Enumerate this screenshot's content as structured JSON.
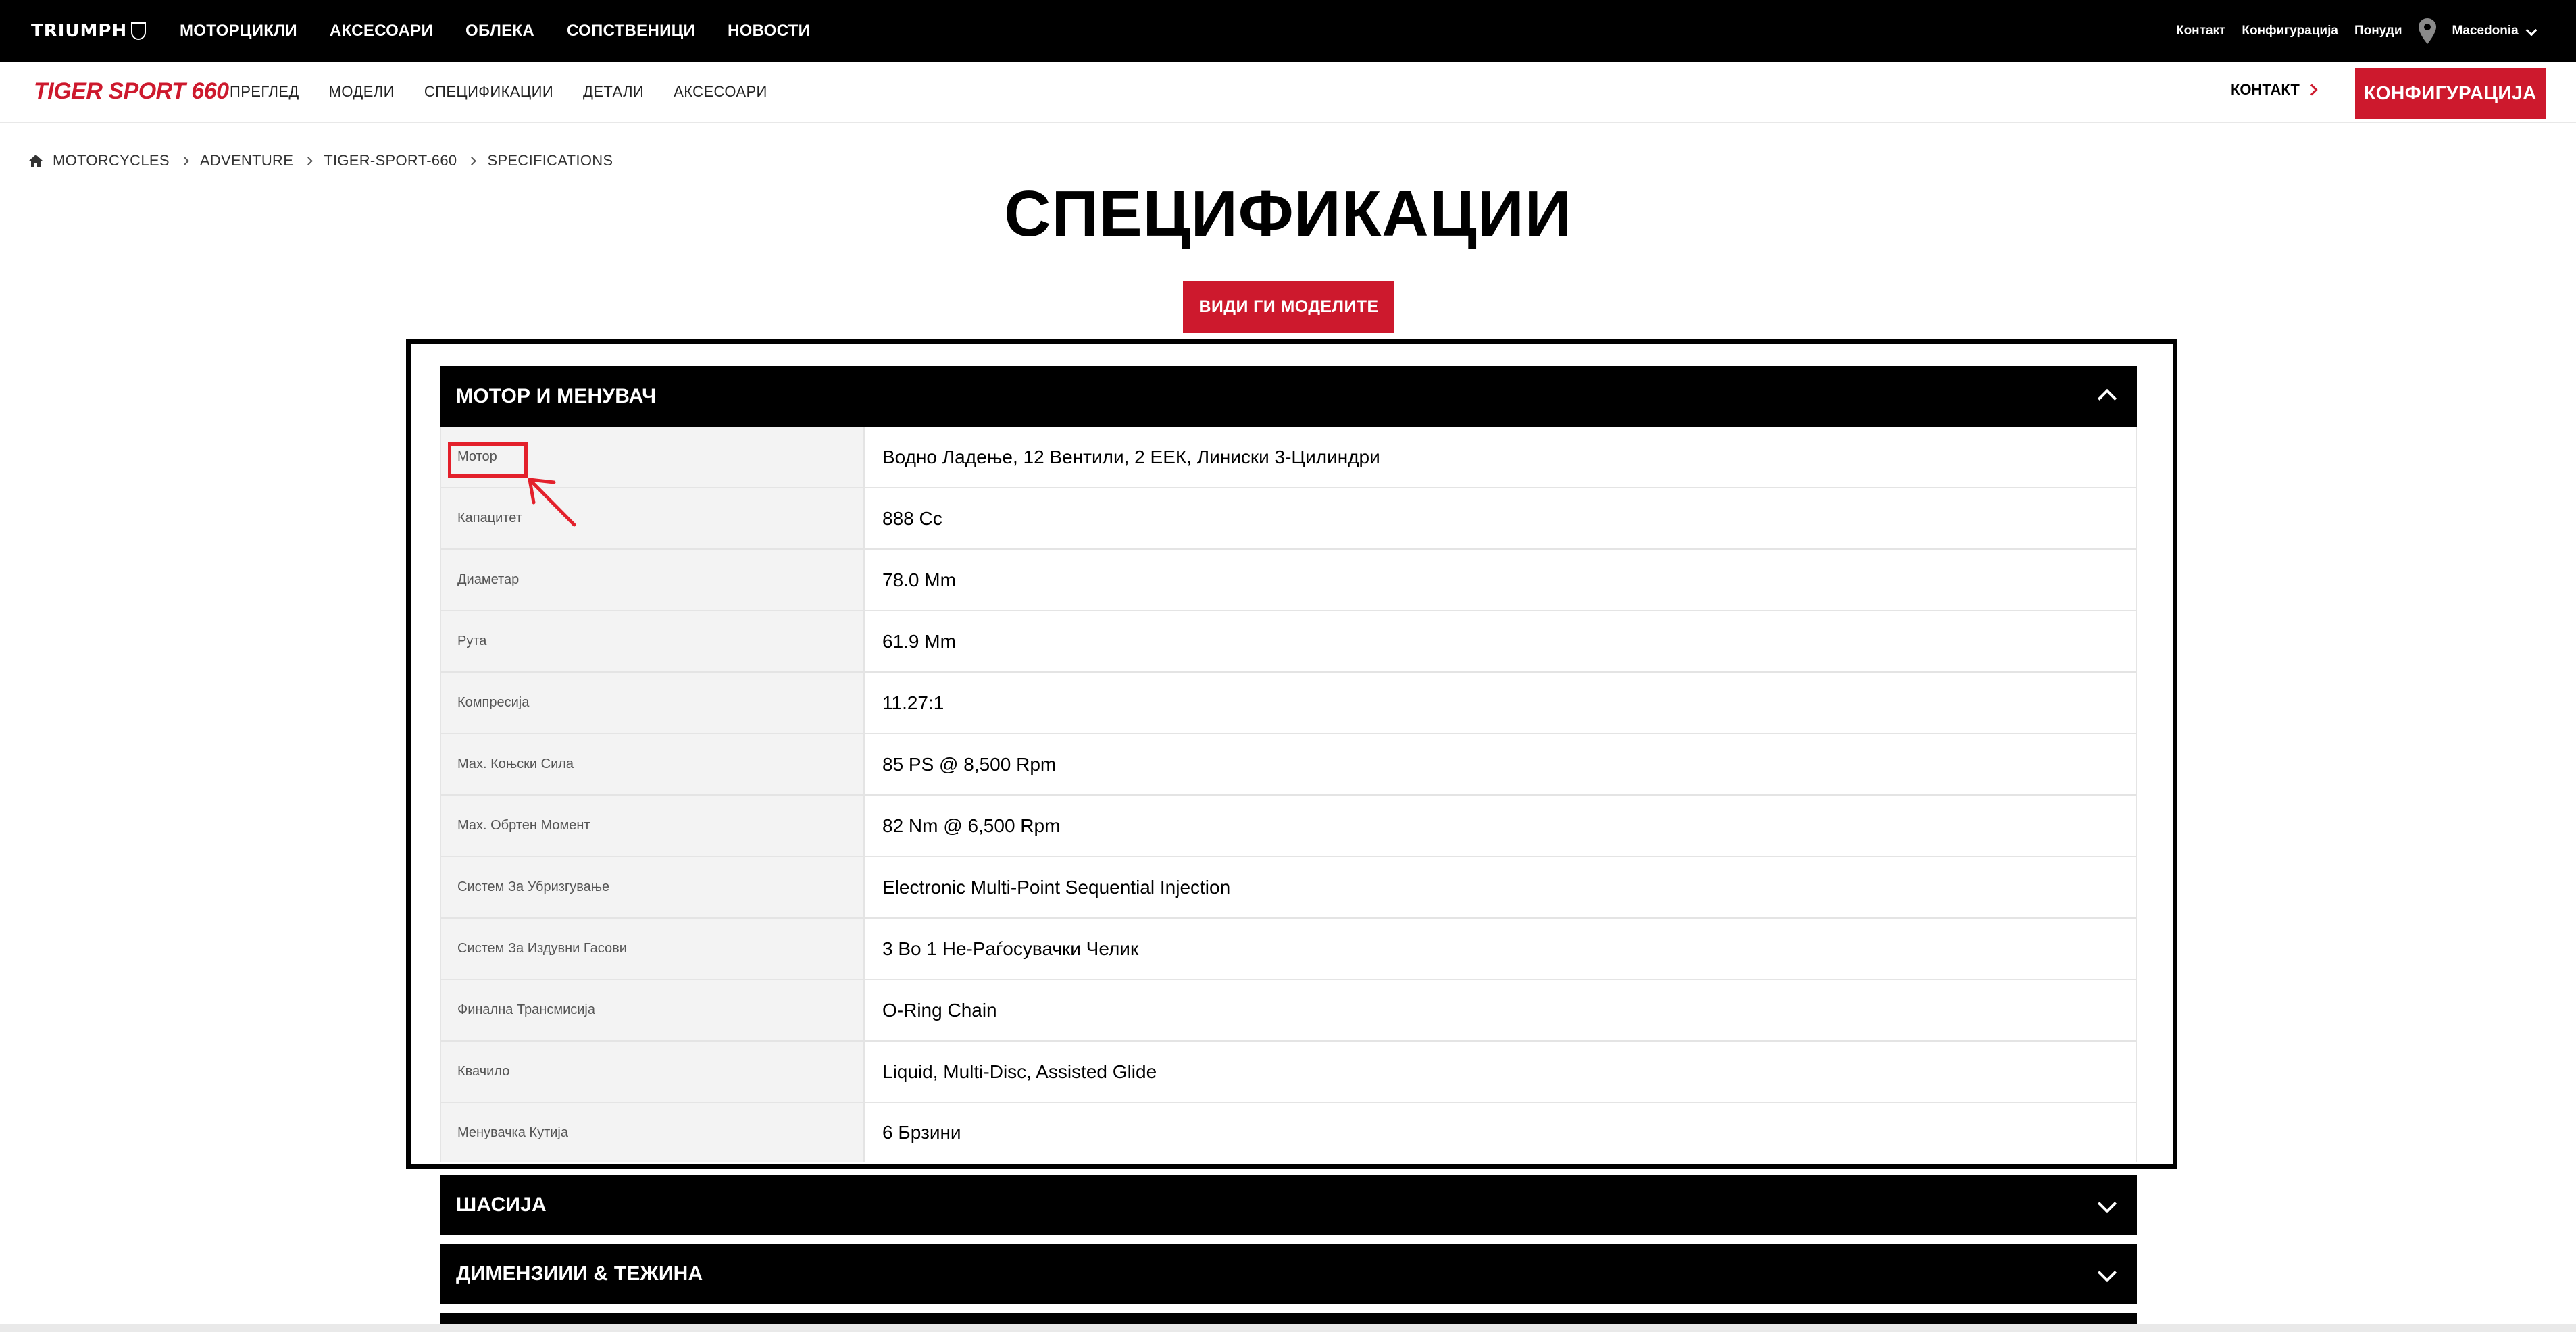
{
  "topbar": {
    "logo_text": "TRIUMPH",
    "nav": [
      "МОТОРЦИКЛИ",
      "АКСЕСОАРИ",
      "ОБЛЕКА",
      "СОПСТВЕНИЦИ",
      "НОВОСТИ"
    ],
    "utility": {
      "contact": "Контакт",
      "config": "Конфигурација",
      "offers": "Понуди",
      "region": "Macedonia",
      "location_icon": "location-pin-icon"
    }
  },
  "subbar": {
    "model_name": "TIGER SPORT 660",
    "nav": [
      "ПРЕГЛЕД",
      "МОДЕЛИ",
      "СПЕЦИФИКАЦИИ",
      "ДЕТАЛИ",
      "АКСЕСОАРИ"
    ],
    "contact_label": "КОНТАКТ",
    "config_button": "КОНФИГУРАЦИЈА"
  },
  "breadcrumb": {
    "home_icon": "home-icon",
    "items": [
      "MOTORCYCLES",
      "ADVENTURE",
      "TIGER-SPORT-660",
      "SPECIFICATIONS"
    ]
  },
  "page": {
    "title": "СПЕЦИФИКАЦИИ",
    "models_button": "ВИДИ ГИ МОДЕЛИТЕ"
  },
  "sections": [
    {
      "title": "МОТОР И МЕНУВАЧ",
      "expanded": true,
      "rows": [
        {
          "label": "Мотор",
          "value": "Водно Ладење, 12 Вентили, 2 ЕЕК, Линиски 3-Цилиндри"
        },
        {
          "label": "Капацитет",
          "value": "888 Cc"
        },
        {
          "label": "Диаметар",
          "value": "78.0 Mm"
        },
        {
          "label": "Рута",
          "value": "61.9 Mm"
        },
        {
          "label": "Компресија",
          "value": "11.27:1"
        },
        {
          "label": "Мах. Коњски Сила",
          "value": "85 PS @ 8,500 Rpm"
        },
        {
          "label": "Мах. Обртен Момент",
          "value": "82 Nm @ 6,500 Rpm"
        },
        {
          "label": "Систем За Убризгување",
          "value": "Electronic Multi-Point Sequential Injection"
        },
        {
          "label": "Систем За Издувни Гасови",
          "value": "3 Во 1 Не-Рaѓосувачки Челик"
        },
        {
          "label": "Финална Трансмисија",
          "value": "O-Ring Chain"
        },
        {
          "label": "Квачило",
          "value": "Liquid, Multi-Disc, Assisted Glide"
        },
        {
          "label": "Менувачка Кутија",
          "value": "6 Брзини"
        }
      ]
    },
    {
      "title": "ШАСИЈА",
      "expanded": false
    },
    {
      "title": "ДИМЕНЗИИИ & ТЕЖИНА",
      "expanded": false
    }
  ],
  "colors": {
    "brand_red": "#cd192d",
    "annotation_red": "#e3202b",
    "header_black": "#000000",
    "label_bg": "#f3f3f3"
  }
}
